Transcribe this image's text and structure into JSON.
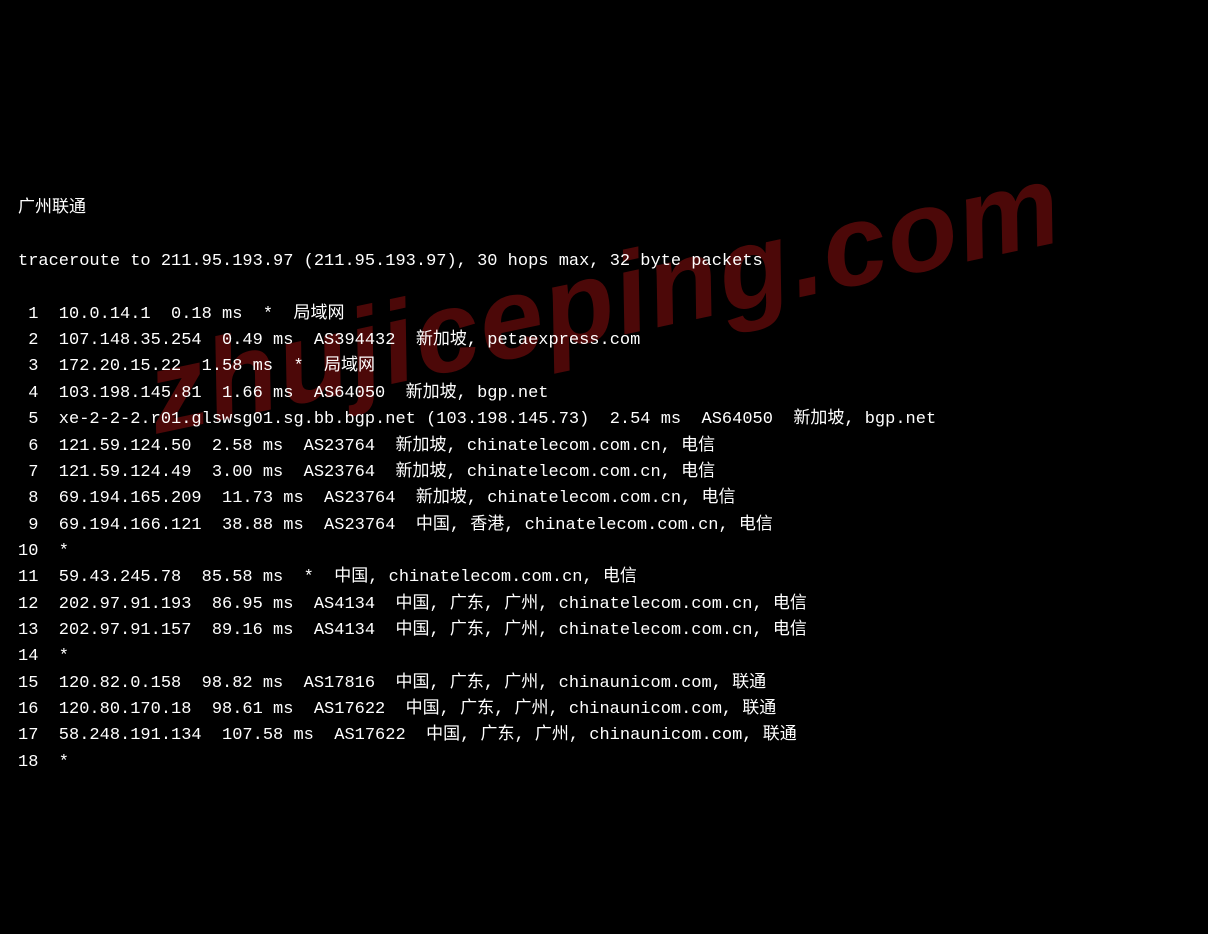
{
  "title": "广州联通",
  "header_line": "traceroute to 211.95.193.97 (211.95.193.97), 30 hops max, 32 byte packets",
  "watermark": "zhujiceping.com",
  "hops": [
    {
      "n": " 1",
      "text": "10.0.14.1  0.18 ms  *  局域网"
    },
    {
      "n": " 2",
      "text": "107.148.35.254  0.49 ms  AS394432  新加坡, petaexpress.com"
    },
    {
      "n": " 3",
      "text": "172.20.15.22  1.58 ms  *  局域网"
    },
    {
      "n": " 4",
      "text": "103.198.145.81  1.66 ms  AS64050  新加坡, bgp.net"
    },
    {
      "n": " 5",
      "text": "xe-2-2-2.r01.glswsg01.sg.bb.bgp.net (103.198.145.73)  2.54 ms  AS64050  新加坡, bgp.net"
    },
    {
      "n": " 6",
      "text": "121.59.124.50  2.58 ms  AS23764  新加坡, chinatelecom.com.cn, 电信"
    },
    {
      "n": " 7",
      "text": "121.59.124.49  3.00 ms  AS23764  新加坡, chinatelecom.com.cn, 电信"
    },
    {
      "n": " 8",
      "text": "69.194.165.209  11.73 ms  AS23764  新加坡, chinatelecom.com.cn, 电信"
    },
    {
      "n": " 9",
      "text": "69.194.166.121  38.88 ms  AS23764  中国, 香港, chinatelecom.com.cn, 电信"
    },
    {
      "n": "10",
      "text": "*"
    },
    {
      "n": "11",
      "text": "59.43.245.78  85.58 ms  *  中国, chinatelecom.com.cn, 电信"
    },
    {
      "n": "12",
      "text": "202.97.91.193  86.95 ms  AS4134  中国, 广东, 广州, chinatelecom.com.cn, 电信"
    },
    {
      "n": "13",
      "text": "202.97.91.157  89.16 ms  AS4134  中国, 广东, 广州, chinatelecom.com.cn, 电信"
    },
    {
      "n": "14",
      "text": "*"
    },
    {
      "n": "15",
      "text": "120.82.0.158  98.82 ms  AS17816  中国, 广东, 广州, chinaunicom.com, 联通"
    },
    {
      "n": "16",
      "text": "120.80.170.18  98.61 ms  AS17622  中国, 广东, 广州, chinaunicom.com, 联通"
    },
    {
      "n": "17",
      "text": "58.248.191.134  107.58 ms  AS17622  中国, 广东, 广州, chinaunicom.com, 联通"
    },
    {
      "n": "18",
      "text": "*"
    }
  ]
}
